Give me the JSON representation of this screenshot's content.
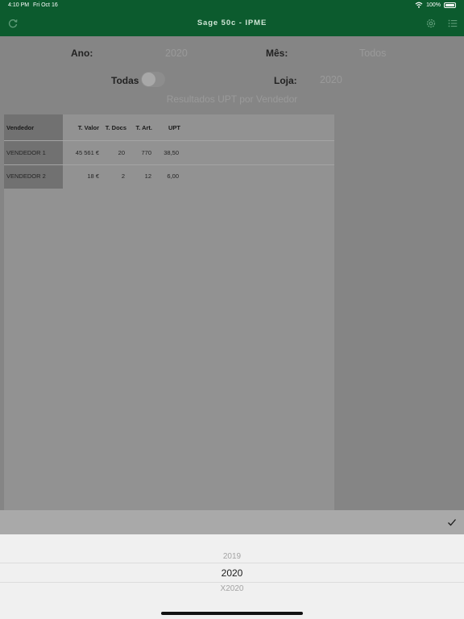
{
  "status_bar": {
    "time": "4:10 PM",
    "date": "Fri Oct 16",
    "battery": "100%"
  },
  "nav": {
    "title": "Sage 50c - IPME"
  },
  "filters": {
    "ano_label": "Ano:",
    "ano_value": "2020",
    "mes_label": "Mês:",
    "mes_value": "Todos",
    "todas_label": "Todas",
    "loja_label": "Loja:",
    "loja_value": "2020"
  },
  "report": {
    "subtitle": "Resultados UPT por Vendedor"
  },
  "table": {
    "headers": [
      "Vendedor",
      "T. Valor",
      "T. Docs",
      "T. Art.",
      "UPT"
    ],
    "rows": [
      [
        "VENDEDOR 1",
        "45 561 €",
        "20",
        "770",
        "38,50"
      ],
      [
        "VENDEDOR 2",
        "18 €",
        "2",
        "12",
        "6,00"
      ]
    ]
  },
  "picker": {
    "options": [
      "2019",
      "2020",
      "X2020"
    ],
    "selected": "2020"
  },
  "colors": {
    "nav_bg": "#0c5b2e"
  }
}
